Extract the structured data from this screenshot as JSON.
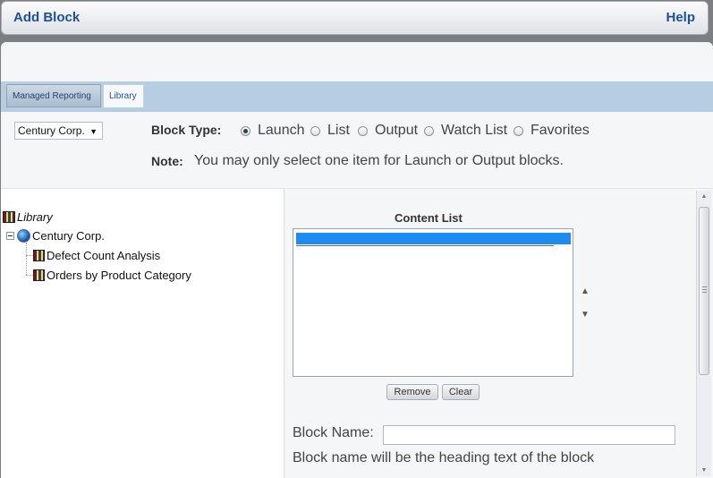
{
  "window": {
    "title": "Add Block",
    "help_label": "Help"
  },
  "tabs": [
    {
      "label": "Managed Reporting",
      "active": true
    },
    {
      "label": "Library",
      "active": false
    }
  ],
  "company_select": {
    "value": "Century Corp."
  },
  "block_type": {
    "label": "Block Type:",
    "options": [
      {
        "label": "Launch",
        "checked": true
      },
      {
        "label": "List",
        "checked": false
      },
      {
        "label": "Output",
        "checked": false
      },
      {
        "label": "Watch List",
        "checked": false
      },
      {
        "label": "Favorites",
        "checked": false
      }
    ]
  },
  "note": {
    "label": "Note:",
    "text": "You may only select one item for Launch or Output blocks."
  },
  "tree": {
    "root": {
      "label": "Library",
      "icon": "library-books-icon"
    },
    "company": {
      "label": "Century Corp.",
      "icon": "globe-icon"
    },
    "children": [
      {
        "label": "Defect Count Analysis",
        "icon": "report-book-icon"
      },
      {
        "label": "Orders by Product Category",
        "icon": "report-book-icon"
      }
    ]
  },
  "content_list": {
    "title": "Content List",
    "selected_color": "#1e8bf0"
  },
  "buttons": {
    "remove": "Remove",
    "clear": "Clear"
  },
  "block_name": {
    "label": "Block Name:",
    "value": "",
    "help": "Block name will be the heading text of the block"
  },
  "colors": {
    "accent": "#1f5096",
    "tab_bar": "#b7cde2"
  }
}
